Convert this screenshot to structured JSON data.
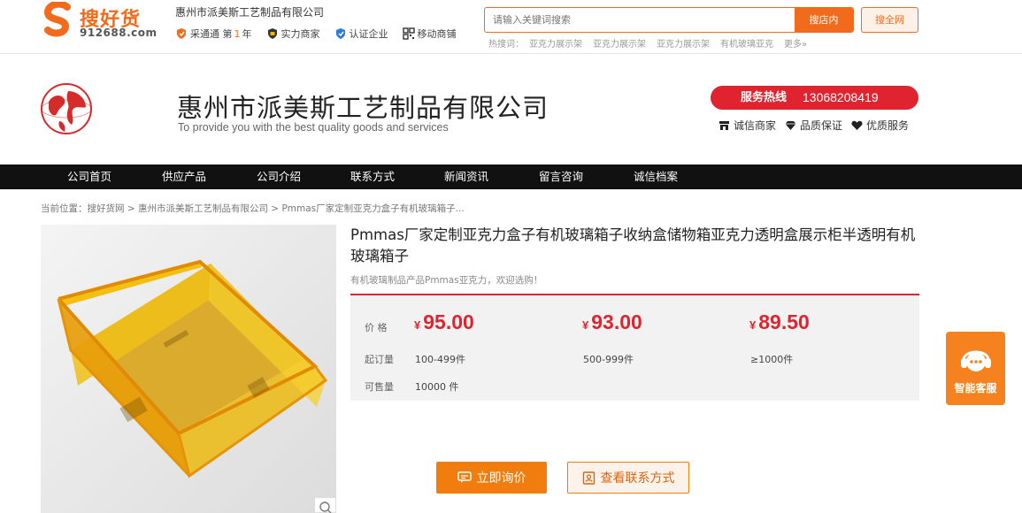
{
  "site": {
    "logo_name": "搜好货",
    "logo_domain": "912688.com",
    "company_name": "惠州市派美斯工艺制品有限公司",
    "badges": [
      {
        "icon": "caitong-shield-icon",
        "text_before": "采通通 第",
        "highlight": "1",
        "text_after": "年"
      },
      {
        "icon": "strength-merchant-icon",
        "text": "实力商家"
      },
      {
        "icon": "certified-enterprise-icon",
        "text": "认证企业"
      },
      {
        "icon": "qr-code-icon",
        "text": "移动商铺"
      }
    ]
  },
  "search": {
    "placeholder": "请输入关键词搜索",
    "button_label": "搜店内",
    "all_button_label": "搜全网",
    "hot_label": "热搜词：",
    "hot_words": [
      "亚克力展示架",
      "亚克力展示架",
      "亚克力展示架",
      "有机玻璃亚克"
    ],
    "more_label": "更多»"
  },
  "company": {
    "title": "惠州市派美斯工艺制品有限公司",
    "slogan": "To provide you with the best quality goods and services",
    "hotline_label": "服务热线",
    "hotline_number": "13068208419",
    "trust": [
      "诚信商家",
      "品质保证",
      "优质服务"
    ]
  },
  "nav": [
    "公司首页",
    "供应产品",
    "公司介绍",
    "联系方式",
    "新闻资讯",
    "留言咨询",
    "诚信档案"
  ],
  "breadcrumb": "当前位置：搜好货网 > 惠州市派美斯工艺制品有限公司 > Pmmas厂家定制亚克力盒子有机玻璃箱子...",
  "product": {
    "title": "Pmmas厂家定制亚克力盒子有机玻璃箱子收纳盒储物箱亚克力透明盒展示柜半透明有机玻璃箱子",
    "subtitle": "有机玻璃制品产品Pmmas亚克力，欢迎选购！",
    "price_label": "价 格",
    "currency": "¥",
    "prices": [
      "95.00",
      "93.00",
      "89.50"
    ],
    "moq_label": "起订量",
    "moq": [
      "100-499件",
      "500-999件",
      "≥1000件"
    ],
    "stock_label": "可售量",
    "stock": "10000 件",
    "inquiry_button": "立即询价",
    "contact_button": "查看联系方式"
  },
  "service": {
    "label": "智能客服"
  },
  "colors": {
    "brand_orange": "#f26b1d",
    "price_red": "#e0242f",
    "button_orange": "#f07d0e",
    "nav_bg": "#111111"
  }
}
